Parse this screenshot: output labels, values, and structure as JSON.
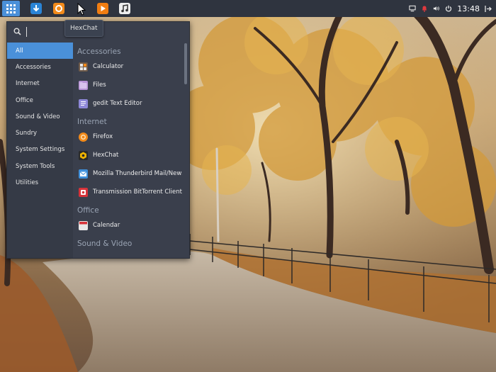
{
  "panel": {
    "clock": "13:48",
    "launcher_icon": "app-grid-icon",
    "tasks": [
      {
        "name": "download-manager-icon",
        "color": "#2a84d6"
      },
      {
        "name": "firefox-icon",
        "color": "#f28a1a"
      },
      {
        "name": "media-player-icon",
        "color": "#f07d12"
      },
      {
        "name": "music-icon",
        "color": "#eeeeee"
      }
    ],
    "tray": [
      "display-icon",
      "notification-bell-icon",
      "volume-icon",
      "power-icon",
      "logout-icon"
    ]
  },
  "tooltip": {
    "text": "HexChat"
  },
  "menu": {
    "search": {
      "value": "",
      "icon": "search-icon"
    },
    "categories": [
      {
        "label": "All",
        "active": true
      },
      {
        "label": "Accessories"
      },
      {
        "label": "Internet"
      },
      {
        "label": "Office"
      },
      {
        "label": "Sound & Video"
      },
      {
        "label": "Sundry"
      },
      {
        "label": "System Settings"
      },
      {
        "label": "System Tools"
      },
      {
        "label": "Utilities"
      }
    ],
    "sections": [
      {
        "title": "Accessories",
        "apps": [
          {
            "label": "Calculator",
            "icon": "calculator-icon",
            "color": "#6f5b4a"
          },
          {
            "label": "Files",
            "icon": "files-icon",
            "color": "#b893d6"
          },
          {
            "label": "gedit Text Editor",
            "icon": "text-editor-icon",
            "color": "#8e88d8"
          }
        ]
      },
      {
        "title": "Internet",
        "apps": [
          {
            "label": "Firefox",
            "icon": "firefox-icon",
            "color": "#f28a1a"
          },
          {
            "label": "HexChat",
            "icon": "hexchat-icon",
            "color": "#2a2a2a"
          },
          {
            "label": "Mozilla Thunderbird Mail/News",
            "icon": "thunderbird-icon",
            "color": "#3f8fd9"
          },
          {
            "label": "Transmission BitTorrent Client",
            "icon": "transmission-icon",
            "color": "#d6333a"
          }
        ]
      },
      {
        "title": "Office",
        "apps": [
          {
            "label": "Calendar",
            "icon": "calendar-icon",
            "color": "#e8e8e8"
          }
        ]
      },
      {
        "title": "Sound & Video",
        "apps": []
      }
    ]
  }
}
